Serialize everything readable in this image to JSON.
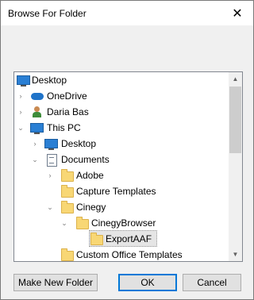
{
  "dialog": {
    "title": "Browse For Folder",
    "close_glyph": "✕"
  },
  "tree": {
    "items": [
      {
        "label": "Desktop",
        "icon": "desktop-icon",
        "expander": ""
      },
      {
        "label": "OneDrive",
        "icon": "onedrive-icon",
        "expander": "collapsed"
      },
      {
        "label": "Daria Bas",
        "icon": "user-icon",
        "expander": "collapsed"
      },
      {
        "label": "This PC",
        "icon": "computer-icon",
        "expander": "expanded"
      },
      {
        "label": "Desktop",
        "icon": "desktop-icon",
        "expander": "collapsed"
      },
      {
        "label": "Documents",
        "icon": "documents-icon",
        "expander": "expanded"
      },
      {
        "label": "Adobe",
        "icon": "folder-icon",
        "expander": "collapsed"
      },
      {
        "label": "Capture Templates",
        "icon": "folder-icon",
        "expander": ""
      },
      {
        "label": "Cinegy",
        "icon": "folder-icon",
        "expander": "expanded"
      },
      {
        "label": "CinegyBrowser",
        "icon": "folder-icon",
        "expander": "expanded"
      },
      {
        "label": "ExportAAF",
        "icon": "folder-icon",
        "expander": "",
        "selected": true
      },
      {
        "label": "Custom Office Templates",
        "icon": "folder-icon",
        "expander": ""
      }
    ],
    "arrows": {
      "collapsed": "›",
      "expanded": "⌄"
    },
    "scroll_up": "▲",
    "scroll_down": "▼"
  },
  "buttons": {
    "new_folder": "Make New Folder",
    "ok": "OK",
    "cancel": "Cancel"
  }
}
